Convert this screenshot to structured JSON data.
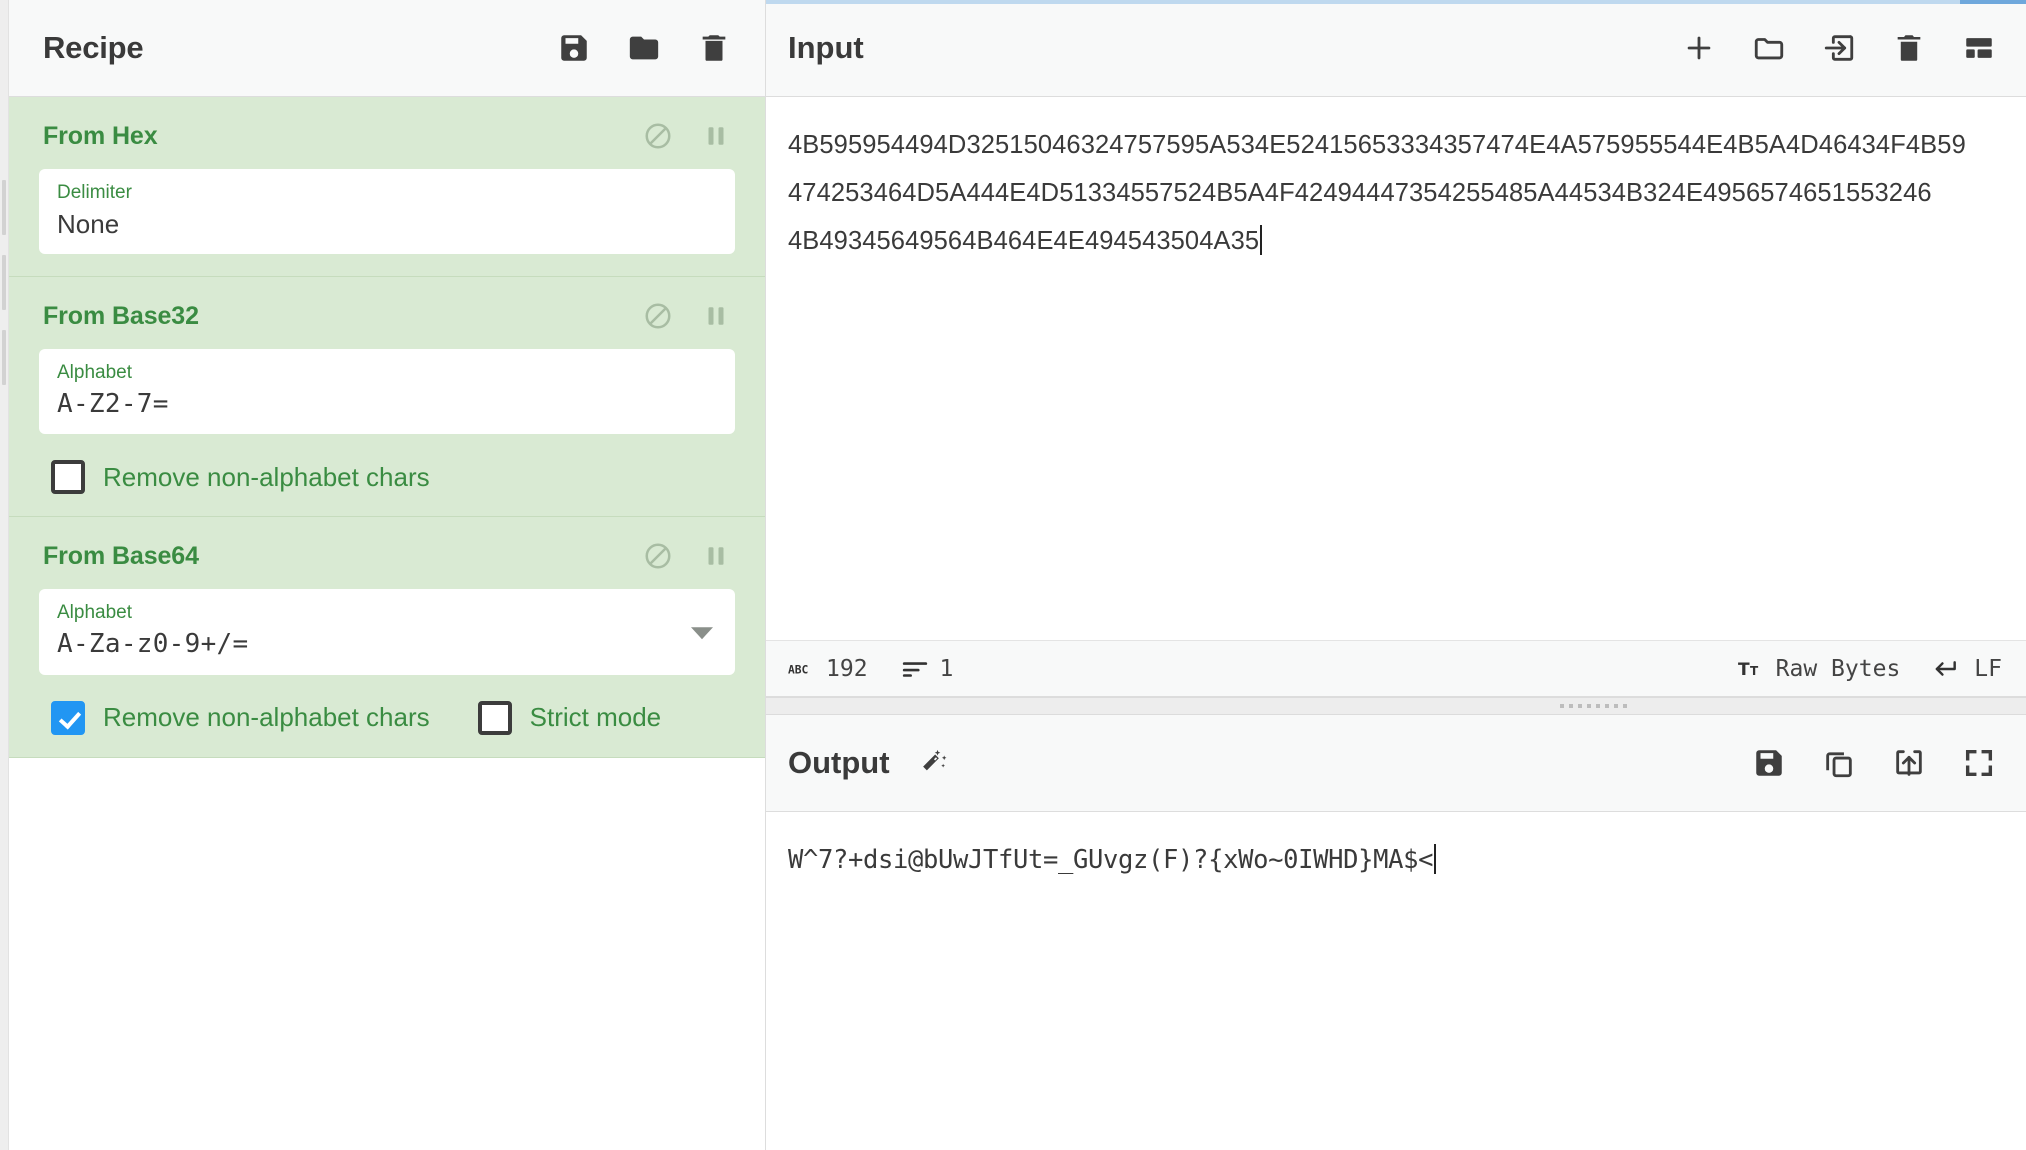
{
  "recipe": {
    "title": "Recipe",
    "toolbar": [
      {
        "name": "save-recipe-icon",
        "label": "Save recipe"
      },
      {
        "name": "load-recipe-icon",
        "label": "Load recipe"
      },
      {
        "name": "clear-recipe-icon",
        "label": "Clear recipe"
      }
    ],
    "operations": [
      {
        "name": "From Hex",
        "args": [
          {
            "label": "Delimiter",
            "value": "None",
            "type": "select-plain"
          }
        ],
        "checkboxes": []
      },
      {
        "name": "From Base32",
        "args": [
          {
            "label": "Alphabet",
            "value": "A-Z2-7=",
            "type": "text"
          }
        ],
        "checkboxes": [
          {
            "label": "Remove non-alphabet chars",
            "checked": false
          }
        ]
      },
      {
        "name": "From Base64",
        "args": [
          {
            "label": "Alphabet",
            "value": "A-Za-z0-9+/=",
            "type": "select"
          }
        ],
        "checkboxes": [
          {
            "label": "Remove non-alphabet chars",
            "checked": true
          },
          {
            "label": "Strict mode",
            "checked": false
          }
        ]
      }
    ]
  },
  "input": {
    "title": "Input",
    "toolbar": [
      {
        "name": "add-input-tab-icon",
        "label": "Add a new input tab"
      },
      {
        "name": "open-folder-as-input-icon",
        "label": "Open folder as input"
      },
      {
        "name": "open-file-as-input-icon",
        "label": "Open file as input"
      },
      {
        "name": "clear-input-icon",
        "label": "Clear input and output"
      },
      {
        "name": "reset-pane-layout-icon",
        "label": "Reset pane layout"
      }
    ],
    "lines": [
      "4B595954494D32515046324757595A534E52415653334357474E4A575955544E4B5A4D46434F4B59",
      "474253464D5A444E4D51334557524B5A4F42494447354255485A44534B324E4956574651553246",
      "4B49345649564B464E4E494543504A35"
    ],
    "status": {
      "length_icon": "abc-icon",
      "length": "192",
      "lines_icon": "lines-icon",
      "lines": "1",
      "encoding_icon": "font-size-icon",
      "encoding": "Raw Bytes",
      "line_ending_icon": "enter-arrow-icon",
      "line_ending": "LF"
    }
  },
  "output": {
    "title": "Output",
    "magic_icon": "magic-wand-icon",
    "toolbar": [
      {
        "name": "save-output-icon",
        "label": "Save output to file"
      },
      {
        "name": "copy-output-icon",
        "label": "Copy raw output"
      },
      {
        "name": "replace-input-icon",
        "label": "Replace input with output"
      },
      {
        "name": "maximise-output-icon",
        "label": "Maximise output pane"
      }
    ],
    "lines": [
      "W^7?+dsi@bUwJTfUt=_GUvgz(F)?{xWo~0IWHD}MA$<"
    ]
  },
  "colors": {
    "op_background": "#d9ead3",
    "op_text": "#3a8c42",
    "checkbox_checked": "#2196f3",
    "panel_header": "#f8f9f9",
    "text_primary": "#3a3a3a"
  }
}
